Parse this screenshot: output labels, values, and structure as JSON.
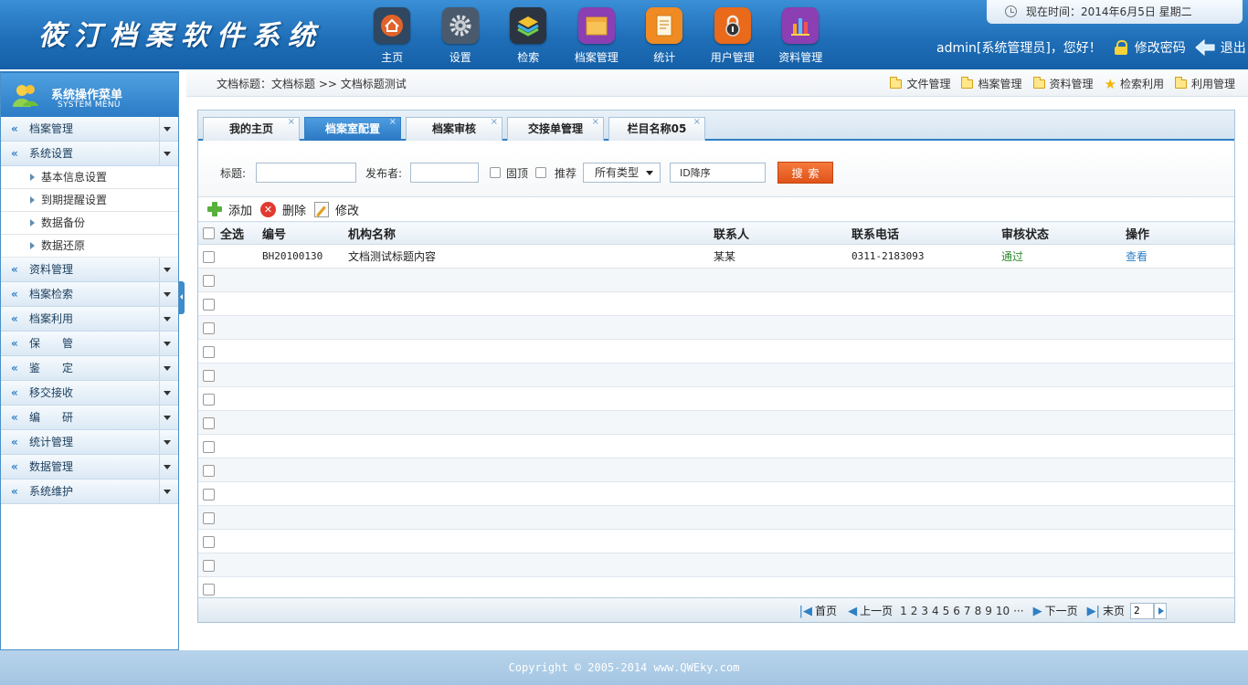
{
  "header": {
    "logo": "筱汀档案软件系统",
    "nav": [
      {
        "label": "主页",
        "icon": "home-icon",
        "color": "#e0632b"
      },
      {
        "label": "设置",
        "icon": "gear-icon",
        "color": "#6b7280"
      },
      {
        "label": "检索",
        "icon": "layers-icon",
        "color": "#3a4a5c"
      },
      {
        "label": "档案管理",
        "icon": "folder-icon",
        "color": "#f0b43a"
      },
      {
        "label": "统计",
        "icon": "document-icon",
        "color": "#f08a22"
      },
      {
        "label": "用户管理",
        "icon": "padlock-icon",
        "color": "#e96a1a"
      },
      {
        "label": "资料管理",
        "icon": "bar-chart-icon",
        "color": "#8b3fb3"
      }
    ],
    "time_label": "现在时间：",
    "time_value": "2014年6月5日 星期二",
    "user": "admin[系统管理员]，您好！",
    "change_password": "修改密码",
    "logout": "退出"
  },
  "sidebar": {
    "title": "系统操作菜单",
    "subtitle": "SYSTEM MENU",
    "items": [
      {
        "label": "档案管理"
      },
      {
        "label": "系统设置",
        "children": [
          "基本信息设置",
          "到期提醒设置",
          "数据备份",
          "数据还原"
        ]
      },
      {
        "label": "资料管理"
      },
      {
        "label": "档案检索"
      },
      {
        "label": "档案利用"
      },
      {
        "label": "保　　管"
      },
      {
        "label": "鉴　　定"
      },
      {
        "label": "移交接收"
      },
      {
        "label": "编　　研"
      },
      {
        "label": "统计管理"
      },
      {
        "label": "数据管理"
      },
      {
        "label": "系统维护"
      }
    ]
  },
  "breadcrumb": "文档标题：文档标题 >> 文档标题测试",
  "shortcuts": [
    {
      "label": "文件管理",
      "icon": "folder-icon"
    },
    {
      "label": "档案管理",
      "icon": "folder-icon"
    },
    {
      "label": "资料管理",
      "icon": "folder-icon"
    },
    {
      "label": "检索利用",
      "icon": "star-icon"
    },
    {
      "label": "利用管理",
      "icon": "folder-icon"
    }
  ],
  "tabs": [
    {
      "label": "我的主页",
      "active": false
    },
    {
      "label": "档案室配置",
      "active": true
    },
    {
      "label": "档案审核",
      "active": false
    },
    {
      "label": "交接单管理",
      "active": false
    },
    {
      "label": "栏目名称05",
      "active": false
    }
  ],
  "search": {
    "title_label": "标题:",
    "title_value": "",
    "publisher_label": "发布者:",
    "publisher_value": "",
    "pinned_label": "固顶",
    "recommend_label": "推荐",
    "type_select": "所有类型",
    "sort_value": "ID降序",
    "button": "搜索"
  },
  "toolbar": {
    "add": "添加",
    "delete": "删除",
    "edit": "修改"
  },
  "table": {
    "headers": {
      "select_all": "全选",
      "code": "编号",
      "org": "机构名称",
      "contact": "联系人",
      "phone": "联系电话",
      "status": "审核状态",
      "op": "操作"
    },
    "rows": [
      {
        "code": "BH20100130",
        "org": "文档测试标题内容",
        "contact": "某某",
        "phone": "0311-2183093",
        "status": "通过",
        "op": "查看"
      }
    ],
    "empty_rows": 14
  },
  "pager": {
    "first": "首页",
    "prev": "上一页",
    "pages": [
      "1",
      "2",
      "3",
      "4",
      "5",
      "6",
      "7",
      "8",
      "9",
      "10"
    ],
    "ellipsis": "···",
    "next": "下一页",
    "last": "末页",
    "input": "2"
  },
  "footer": "Copyright © 2005-2014 www.QWEky.com"
}
